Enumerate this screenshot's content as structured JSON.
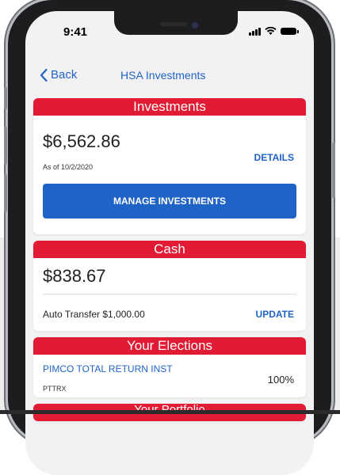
{
  "status_bar": {
    "time": "9:41"
  },
  "nav": {
    "back_label": "Back",
    "title": "HSA Investments"
  },
  "investments": {
    "header": "Investments",
    "amount": "$6,562.86",
    "as_of": "As of 10/2/2020",
    "details_label": "DETAILS",
    "manage_label": "MANAGE INVESTMENTS"
  },
  "cash": {
    "header": "Cash",
    "amount": "$838.67",
    "auto_transfer": "Auto Transfer $1,000.00",
    "update_label": "UPDATE"
  },
  "elections": {
    "header": "Your Elections",
    "items": [
      {
        "name": "PIMCO TOTAL RETURN INST",
        "ticker": "PTTRX",
        "percent": "100%"
      }
    ]
  },
  "next_section": {
    "header": "Your Portfolio"
  },
  "colors": {
    "accent_red": "#e11b34",
    "link_blue": "#1f63c6"
  }
}
